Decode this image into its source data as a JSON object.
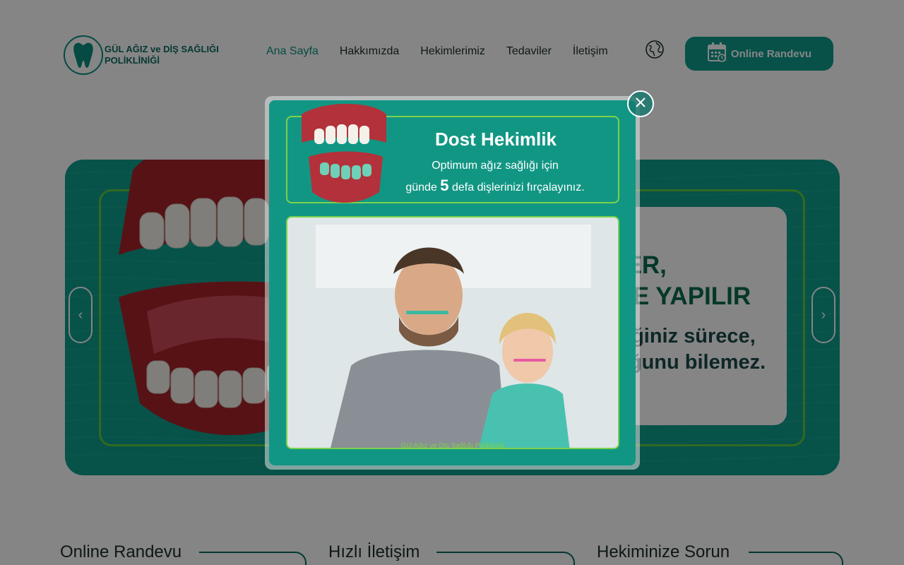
{
  "brand": {
    "name": "GÜL AĞIZ ve DİŞ SAĞLIĞI POLİKLİNİĞİ",
    "accent": "#0e9b8c",
    "frame_green": "#5ecb3e"
  },
  "nav": {
    "items": [
      {
        "label": "Ana Sayfa",
        "active": true
      },
      {
        "label": "Hakkımızda",
        "active": false
      },
      {
        "label": "Hekimlerimiz",
        "active": false
      },
      {
        "label": "Tedaviler",
        "active": false
      },
      {
        "label": "İletişim",
        "active": false
      }
    ],
    "language_icon": "globe-icon",
    "cta_label": "Online Randevu",
    "cta_icon": "calendar-icon"
  },
  "hero": {
    "title_line1": "PROTEZ DİŞLER,",
    "title_line2": "MÜKEMMEL İŞÇİLİKLE YAPILIR",
    "subtitle_line1": "Onlara kendiniz söylemediğiniz sürece,",
    "subtitle_line2": "kimse sizde protez diş olduğunu bilemez.",
    "prev_icon": "chevron-left-icon",
    "next_icon": "chevron-right-icon"
  },
  "sections": [
    {
      "title": "Online Randevu"
    },
    {
      "title": "Hızlı İletişim"
    },
    {
      "title": "Hekiminize Sorun"
    }
  ],
  "modal": {
    "title": "Dost Hekimlik",
    "line1": "Optimum ağız sağlığı için",
    "line2_before": "günde",
    "line2_number": "5",
    "line2_after": "defa dişlerinizi fırçalayınız.",
    "caption": "Gül Ağız ve Diş Sağlığı Polikliniği",
    "close_icon": "close-icon"
  }
}
